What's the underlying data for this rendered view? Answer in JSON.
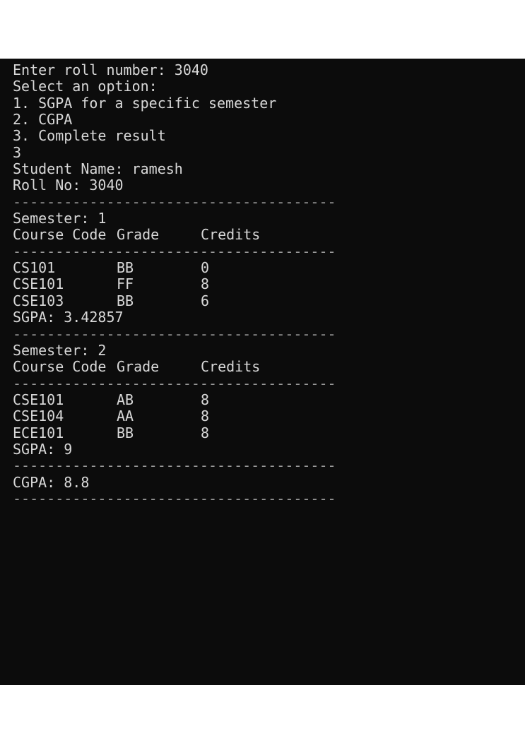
{
  "prompt_roll": "Enter roll number: 3040",
  "menu": {
    "title": "Select an option:",
    "options": [
      "1. SGPA for a specific semester",
      "2. CGPA",
      "3. Complete result"
    ]
  },
  "choice": "3",
  "student": {
    "name_line": "Student Name: ramesh",
    "roll_line": "Roll No: 3040"
  },
  "separator": "--------------------------------------",
  "table_header": {
    "code": "Course Code",
    "grade": "Grade",
    "credits": "Credits"
  },
  "semesters": [
    {
      "title": "Semester: 1",
      "rows": [
        {
          "code": "CS101",
          "grade": "BB",
          "credits": "0"
        },
        {
          "code": "CSE101",
          "grade": "FF",
          "credits": "8"
        },
        {
          "code": "CSE103",
          "grade": "BB",
          "credits": "6"
        }
      ],
      "sgpa": "SGPA: 3.42857"
    },
    {
      "title": "Semester: 2",
      "rows": [
        {
          "code": "CSE101",
          "grade": "AB",
          "credits": "8"
        },
        {
          "code": "CSE104",
          "grade": "AA",
          "credits": "8"
        },
        {
          "code": "ECE101",
          "grade": "BB",
          "credits": "8"
        }
      ],
      "sgpa": "SGPA: 9"
    }
  ],
  "cgpa": "CGPA: 8.8"
}
